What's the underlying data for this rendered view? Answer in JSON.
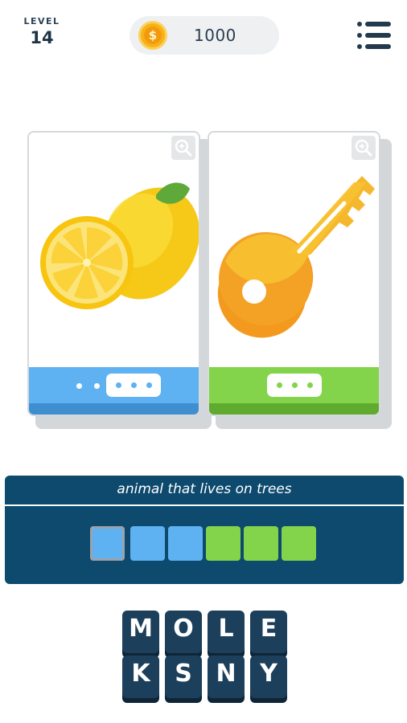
{
  "header": {
    "level_label": "LEVEL",
    "level_number": "14",
    "coins": "1000",
    "coin_symbol": "$"
  },
  "cards": [
    {
      "picture": "lemon",
      "dots_outside": 2,
      "dots_in_box": 3,
      "strip_color": "#5fb2f2"
    },
    {
      "picture": "key",
      "dots_outside": 0,
      "dots_in_box": 3,
      "strip_color": "#83d44a"
    }
  ],
  "clue": "animal that lives on trees",
  "answer_slots": [
    {
      "color": "blue",
      "letter": ""
    },
    {
      "color": "blue",
      "letter": ""
    },
    {
      "color": "blue",
      "letter": ""
    },
    {
      "color": "green",
      "letter": ""
    },
    {
      "color": "green",
      "letter": ""
    },
    {
      "color": "green",
      "letter": ""
    }
  ],
  "letters_row1": [
    "M",
    "O",
    "L",
    "E"
  ],
  "letters_row2": [
    "K",
    "S",
    "N",
    "Y"
  ],
  "colors": {
    "navy": "#0d4a6e",
    "tile": "#1c3f5c",
    "blue": "#5fb2f2",
    "green": "#83d44a",
    "coin": "#f7b21a"
  }
}
